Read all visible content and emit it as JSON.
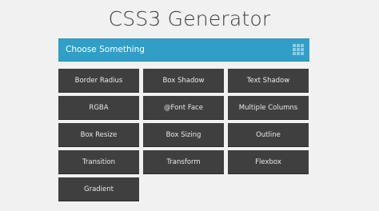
{
  "header": {
    "title": "CSS3 Generator"
  },
  "select": {
    "label": "Choose Something",
    "icon": "grid-icon",
    "color": "#2f9fc7"
  },
  "buttons": [
    "Border Radius",
    "Box Shadow",
    "Text Shadow",
    "RGBA",
    "@Font Face",
    "Multiple Columns",
    "Box Resize",
    "Box Sizing",
    "Outline",
    "Transition",
    "Transform",
    "Flexbox",
    "Gradient"
  ],
  "colors": {
    "background": "#f1f1f1",
    "button": "#3f3f3f",
    "accent": "#2f9fc7"
  }
}
